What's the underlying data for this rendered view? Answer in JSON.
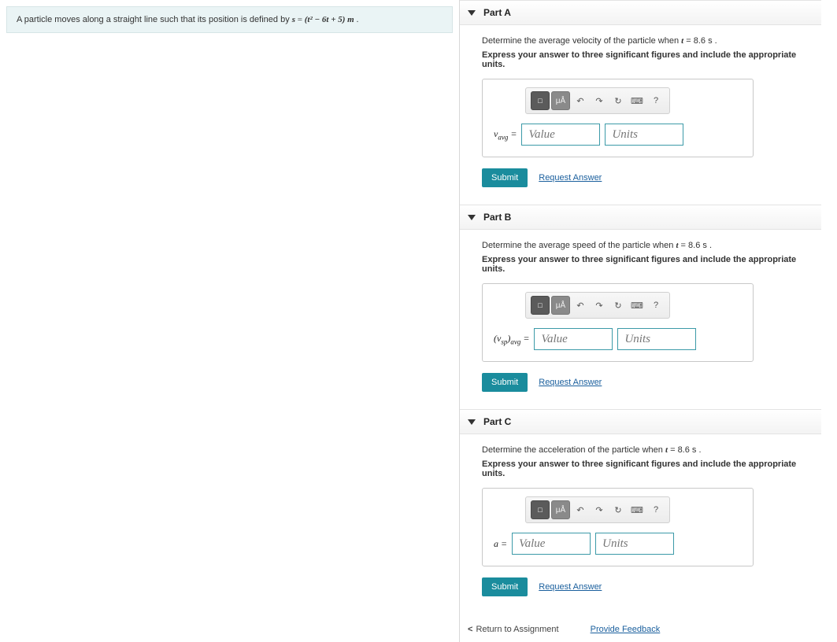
{
  "problem": {
    "prefix": "A particle moves along a straight line such that its position is defined by ",
    "eq_lhs": "s",
    "eq_rhs": "(t² − 6t + 5) m",
    "suffix": "."
  },
  "parts": [
    {
      "title": "Part A",
      "prompt_pre": "Determine the average velocity of the particle when ",
      "prompt_var": "t",
      "prompt_val": " = 8.6  s",
      "prompt_post": " .",
      "bold": "Express your answer to three significant figures and include the appropriate units.",
      "var_html": "v<sub>avg</sub> =",
      "value_ph": "Value",
      "units_ph": "Units",
      "submit": "Submit",
      "request": "Request Answer"
    },
    {
      "title": "Part B",
      "prompt_pre": "Determine the average speed of the particle when ",
      "prompt_var": "t",
      "prompt_val": " = 8.6  s",
      "prompt_post": " .",
      "bold": "Express your answer to three significant figures and include the appropriate units.",
      "var_html": "(v<sub>sp</sub>)<sub>avg</sub> =",
      "value_ph": "Value",
      "units_ph": "Units",
      "submit": "Submit",
      "request": "Request Answer"
    },
    {
      "title": "Part C",
      "prompt_pre": "Determine the acceleration of the particle when ",
      "prompt_var": "t",
      "prompt_val": " = 8.6  s",
      "prompt_post": " .",
      "bold": "Express your answer to three significant figures and include the appropriate units.",
      "var_html": "a =",
      "value_ph": "Value",
      "units_ph": "Units",
      "submit": "Submit",
      "request": "Request Answer"
    }
  ],
  "toolbar": {
    "templates": "□",
    "symbols": "μÅ",
    "undo": "↶",
    "redo": "↷",
    "reset": "↻",
    "keyboard": "⌨",
    "help": "?"
  },
  "footer": {
    "return": "Return to Assignment",
    "feedback": "Provide Feedback"
  }
}
